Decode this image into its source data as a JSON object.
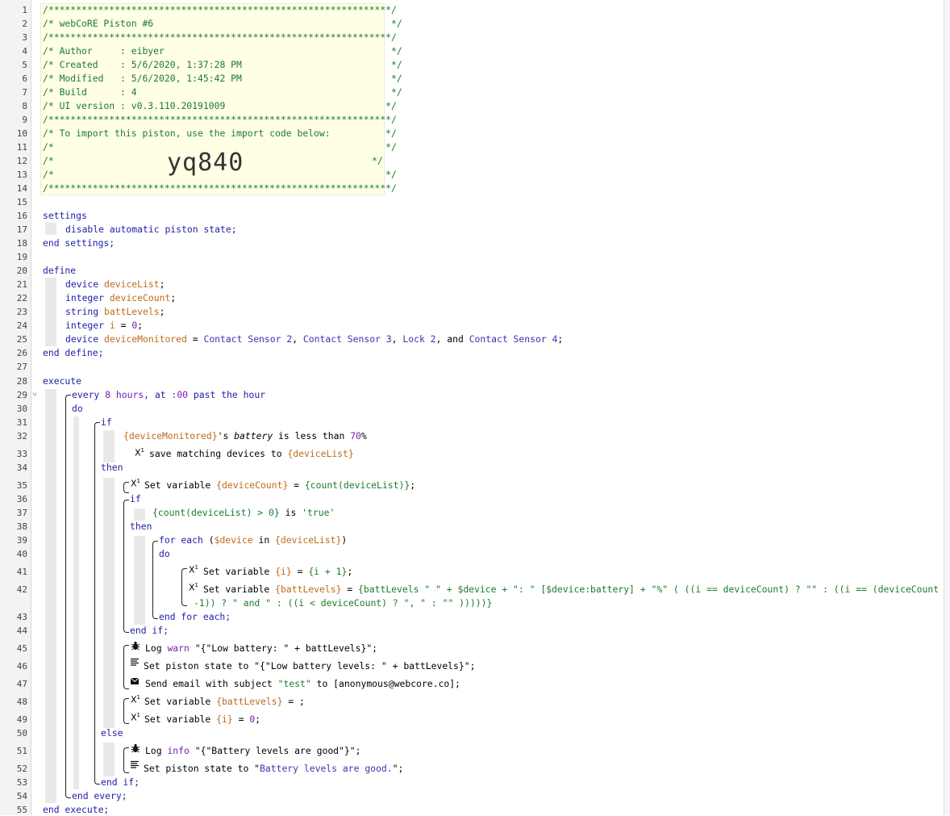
{
  "line_numbers": [
    "1",
    "2",
    "3",
    "4",
    "5",
    "6",
    "7",
    "8",
    "9",
    "10",
    "11",
    "12",
    "13",
    "14",
    "15",
    "16",
    "17",
    "18",
    "19",
    "20",
    "21",
    "22",
    "23",
    "24",
    "25",
    "26",
    "27",
    "28",
    "29",
    "30",
    "31",
    "32",
    "33",
    "34",
    "35",
    "36",
    "37",
    "38",
    "39",
    "40",
    "41",
    "42",
    "43",
    "44",
    "45",
    "46",
    "47",
    "48",
    "49",
    "50",
    "51",
    "52",
    "53",
    "54",
    "55"
  ],
  "header": {
    "border": "/**************************************************************/",
    "title": "/* webCoRE Piston #6                                           */",
    "author": "/* Author     : eibyer                                         */",
    "created": "/* Created    : 5/6/2020, 1:37:28 PM                           */",
    "modified": "/* Modified   : 5/6/2020, 1:45:42 PM                           */",
    "build": "/* Build      : 4                                              */",
    "ui_version": "/* UI version : v0.3.110.20191009                             */",
    "import_note": "/* To import this piston, use the import code below:          */",
    "blank": "/*                                                            */",
    "import_code_prefix": "/*",
    "import_code_suffix": "*/",
    "import_code": "yq840"
  },
  "code": {
    "settings": "settings",
    "disable": "disable automatic piston state;",
    "end_settings": "end settings;",
    "define": "define",
    "device": "device",
    "integer": "integer",
    "string": "string",
    "v_deviceList": "deviceList",
    "v_deviceCount": "deviceCount",
    "v_battLevels": "battLevels",
    "v_i": "i",
    "v_deviceMonitored": "deviceMonitored",
    "semi": ";",
    "eq": " = ",
    "zero": "0",
    "dev_cs2": "Contact Sensor 2",
    "dev_cs3": "Contact Sensor 3",
    "dev_lock2": "Lock 2",
    "dev_cs4": "Contact Sensor 4",
    "comma": ", ",
    "and": ", and ",
    "end_define": "end define;",
    "execute": "execute",
    "every": "every",
    "every_val": "8 hours",
    "every_at": ", at ",
    "every_time": ":00",
    "every_past": " past the hour",
    "do": "do",
    "if": "if",
    "cond1_var": "{deviceMonitored}",
    "cond1_mid": "'s ",
    "cond1_attr": "battery",
    "cond1_op": " is less than ",
    "cond1_val": "70",
    "cond1_unit": "%",
    "save_text": "save matching devices to ",
    "save_var": "{deviceList}",
    "then": "then",
    "set_variable": "Set variable ",
    "sv1_var": "{deviceCount}",
    "sv1_expr": "{count(deviceList)}",
    "sv1_end": ";",
    "cond2_expr": "{count(deviceList) > 0}",
    "cond2_is": " is ",
    "cond2_val": "'true'",
    "for_each": "for each",
    "for_open": " (",
    "for_var": "$device",
    "for_in": " in ",
    "for_list": "{deviceList}",
    "for_close": ")",
    "sv2_var": "{i}",
    "sv2_expr": "{i + 1}",
    "sv3_var": "{battLevels}",
    "sv3_expr_a": "{battLevels \" \" + $device + \": \" [$device:battery] + \"%\" ( ((i == deviceCount) ? \"\" : ((i == (deviceCount",
    "sv3_expr_b": "-1)) ? \" and \" : ((i < deviceCount) ? \", \" : \"\" )))))}",
    "end_for_each": "end for each;",
    "end_if": "end if;",
    "log": "Log ",
    "warn": "warn",
    "log_warn_msg": " \"{\"Low battery: \" + battLevels}\";",
    "set_state": "Set piston state to ",
    "state_expr": "\"{\"Low battery levels: \" + battLevels}\";",
    "send_email": "Send email with subject ",
    "email_subject": "\"test\"",
    "email_to": " to [anonymous@webcore.co];",
    "sv4_var": "{battLevels}",
    "sv4_rest": " = ;",
    "sv5_var": "{i}",
    "sv5_rest": " = ",
    "else": "else",
    "info": "info",
    "log_info_msg": " \"{\"Battery levels are good\"}\";",
    "state_good_q1": "\"",
    "state_good_text": "Battery levels are good.",
    "state_good_q2": "\";",
    "end_every": "end every;",
    "end_execute": "end execute;"
  },
  "icons": {
    "variable": "X",
    "variable_sup": "1",
    "bug": "bug-icon",
    "text": "text-lines-icon",
    "email": "email-icon",
    "fork": "fork-icon"
  },
  "colors": {
    "comment": "#1b7b2a",
    "keyword": "#2121a8",
    "variable": "#c06a1a",
    "device": "#4b2bb3",
    "number": "#7a1bb3",
    "header_bg": "#ffffe6"
  }
}
